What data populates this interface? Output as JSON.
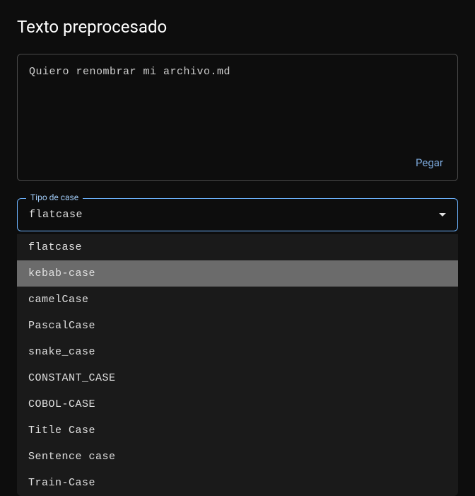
{
  "heading": "Texto preprocesado",
  "textarea": {
    "value": "Quiero renombrar mi archivo.md",
    "paste_label": "Pegar"
  },
  "select": {
    "label": "Tipo de case",
    "value": "flatcase",
    "options": [
      {
        "label": "flatcase",
        "hovered": false
      },
      {
        "label": "kebab-case",
        "hovered": true
      },
      {
        "label": "camelCase",
        "hovered": false
      },
      {
        "label": "PascalCase",
        "hovered": false
      },
      {
        "label": "snake_case",
        "hovered": false
      },
      {
        "label": "CONSTANT_CASE",
        "hovered": false
      },
      {
        "label": "COBOL-CASE",
        "hovered": false
      },
      {
        "label": "Title Case",
        "hovered": false
      },
      {
        "label": "Sentence case",
        "hovered": false
      },
      {
        "label": "Train-Case",
        "hovered": false
      }
    ]
  }
}
